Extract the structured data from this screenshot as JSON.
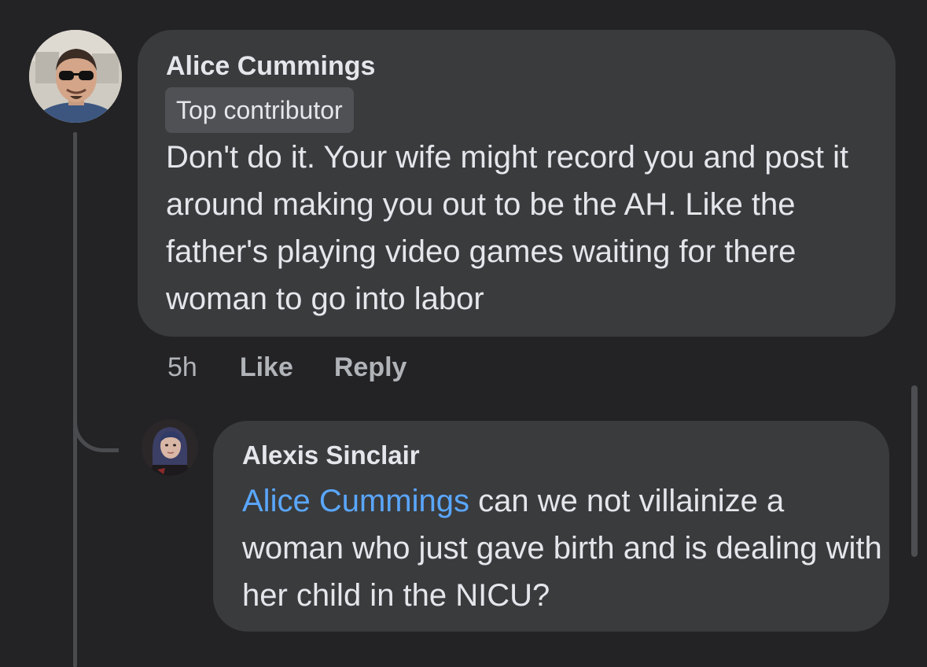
{
  "comment": {
    "author": "Alice Cummings",
    "badge": "Top contributor",
    "text": "Don't do it. Your wife might record you and post it around making you out to be the AH. Like the father's playing video games waiting for there woman to go into labor",
    "timestamp": "5h",
    "like_label": "Like",
    "reply_label": "Reply"
  },
  "reply": {
    "author": "Alexis Sinclair",
    "mention": "Alice Cummings",
    "text": " can we not villainize a woman who just gave birth and is dealing with her child in the NICU?"
  },
  "colors": {
    "background": "#232325",
    "bubble": "#3a3b3d",
    "badge": "#505154",
    "mention": "#5aa7ff",
    "secondary_text": "#b0b3b8"
  }
}
